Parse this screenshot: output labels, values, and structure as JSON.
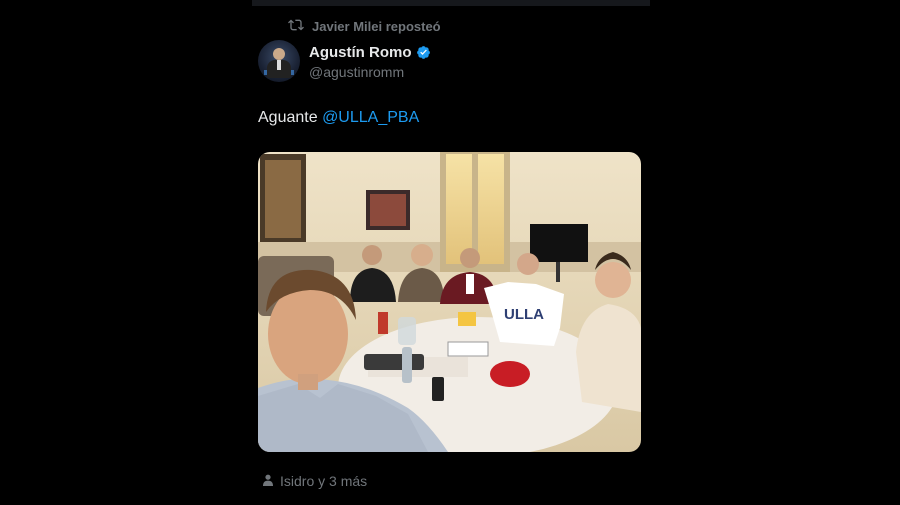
{
  "repost": {
    "icon": "repost-icon",
    "text": "Javier Milei reposteó"
  },
  "author": {
    "name": "Agustín Romo",
    "handle": "@agustinromm",
    "verified_color": "#1d9bf0"
  },
  "tweet": {
    "text": "Aguante ",
    "mention": "@ULLA_PBA",
    "mention_color": "#1d9bf0"
  },
  "photo": {
    "shirt_text": "ULLA"
  },
  "likes": {
    "icon": "person-icon",
    "text": "Isidro y 3 más"
  }
}
